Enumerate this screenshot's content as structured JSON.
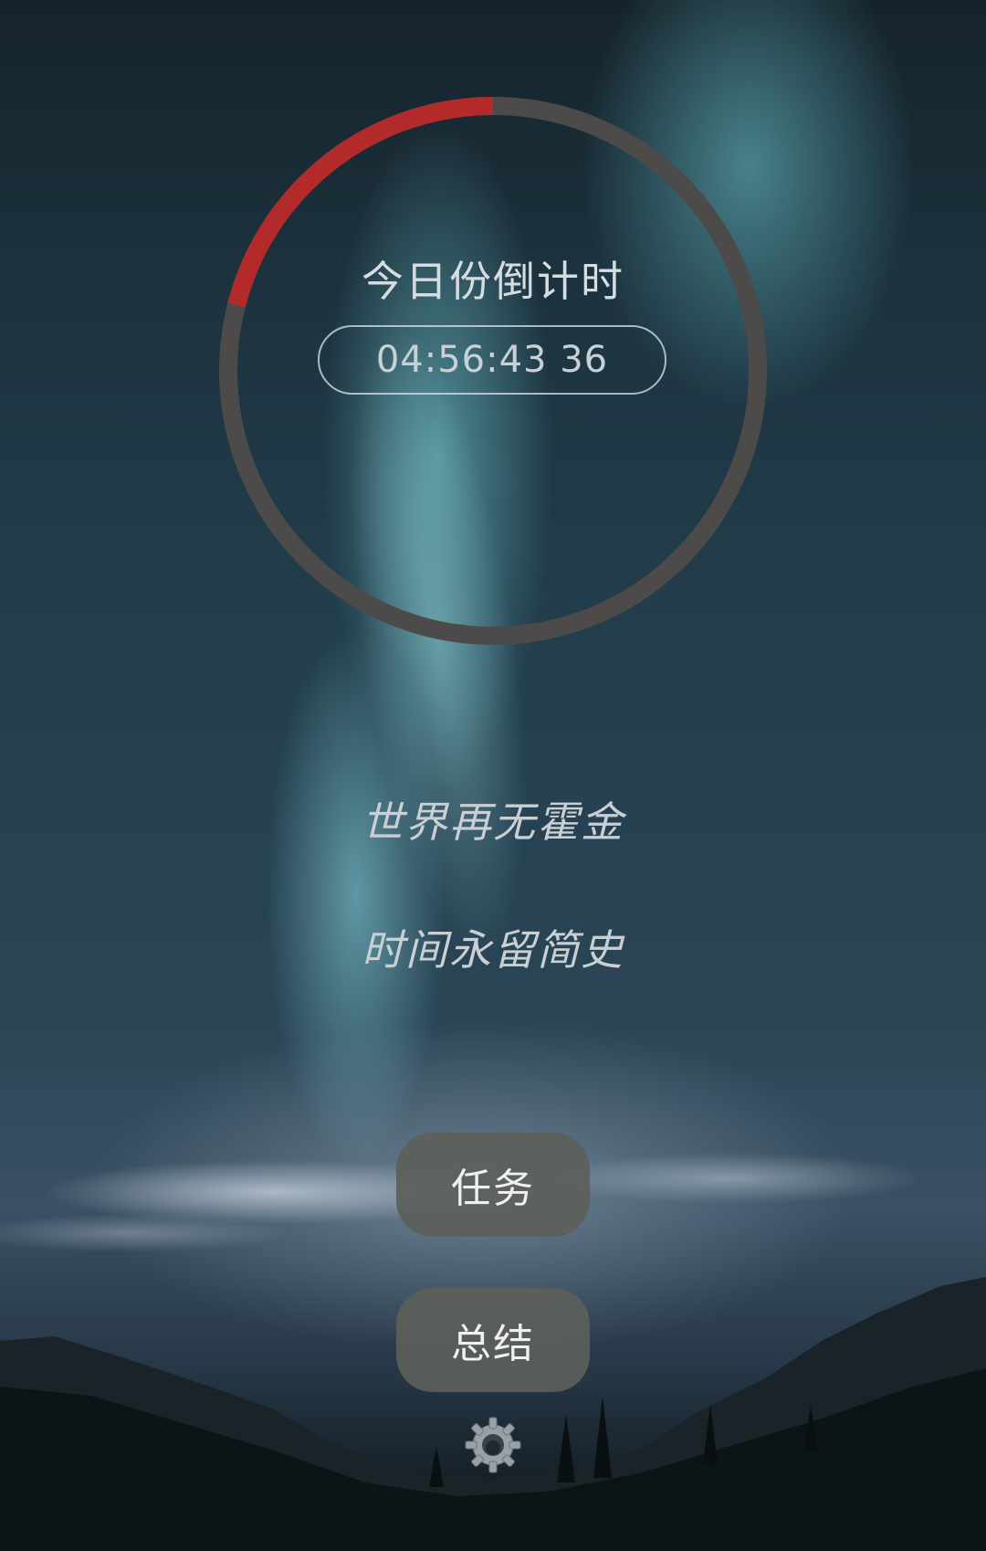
{
  "countdown": {
    "title": "今日份倒计时",
    "time": "04:56:43 36",
    "progress_fraction": 0.21,
    "progress_color": "#b32a2a",
    "track_color": "#4d4a4a"
  },
  "quotes": {
    "line1": "世界再无霍金",
    "line2": "时间永留简史"
  },
  "buttons": {
    "tasks_label": "任务",
    "summary_label": "总结"
  },
  "icons": {
    "settings": "gear-icon"
  }
}
